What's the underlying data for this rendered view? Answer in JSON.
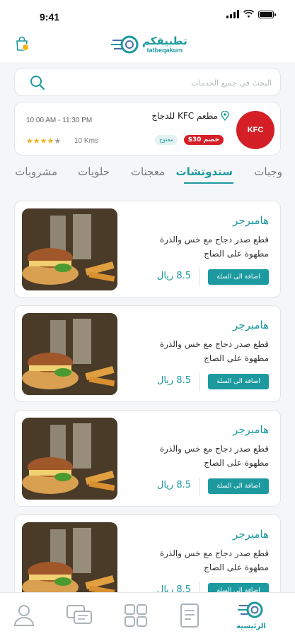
{
  "status_bar": {
    "time": "9:41"
  },
  "colors": {
    "accent": "#1c9aa0",
    "star": "#f2b21b",
    "kfc_red": "#d51f26"
  },
  "header": {
    "logo_ar": "تطبيقكم",
    "logo_en": "tatbeqakum",
    "cart_icon": "shopping-bag-icon"
  },
  "search": {
    "placeholder": "البحث في جميع الخدمات"
  },
  "restaurant": {
    "name": "مطعم KFC للدجاج",
    "logo_text": "KFC",
    "hours": "10:00 AM - 11:30 PM",
    "rating": 4,
    "rating_max": 5,
    "distance": "10 Kms",
    "discount_badge": "خصم 30$",
    "status_badge": "مفتوح"
  },
  "tabs": [
    {
      "label": "وجبات",
      "active": false
    },
    {
      "label": "سندوتشات",
      "active": true
    },
    {
      "label": "معجنات",
      "active": false
    },
    {
      "label": "حلويات",
      "active": false
    },
    {
      "label": "مشروبات",
      "active": false
    }
  ],
  "products": [
    {
      "title": "هامبرجر",
      "desc": "قطع صدر دجاج مع خس والذرة مطهوة على الصاج",
      "price": "8.5 ريال",
      "button": "اضافة الى السلة"
    },
    {
      "title": "هامبرجر",
      "desc": "قطع صدر دجاج مع خس والذرة مطهوة على الصاج",
      "price": "8.5 ريال",
      "button": "اضافة الى السلة"
    },
    {
      "title": "هامبرجر",
      "desc": "قطع صدر دجاج مع خس والذرة مطهوة على الصاج",
      "price": "8.5 ريال",
      "button": "اضافة الى السلة"
    },
    {
      "title": "هامبرجر",
      "desc": "قطع صدر دجاج مع خس والذرة مطهوة على الصاج",
      "price": "8.5 ريال",
      "button": "اضافة الى السلة"
    }
  ],
  "bottom_nav": {
    "items": [
      {
        "icon": "user-icon"
      },
      {
        "icon": "chat-icon"
      },
      {
        "icon": "grid-icon"
      },
      {
        "icon": "document-icon"
      },
      {
        "icon": "home-logo-icon",
        "label": "الرئيسية",
        "active": true
      }
    ]
  }
}
